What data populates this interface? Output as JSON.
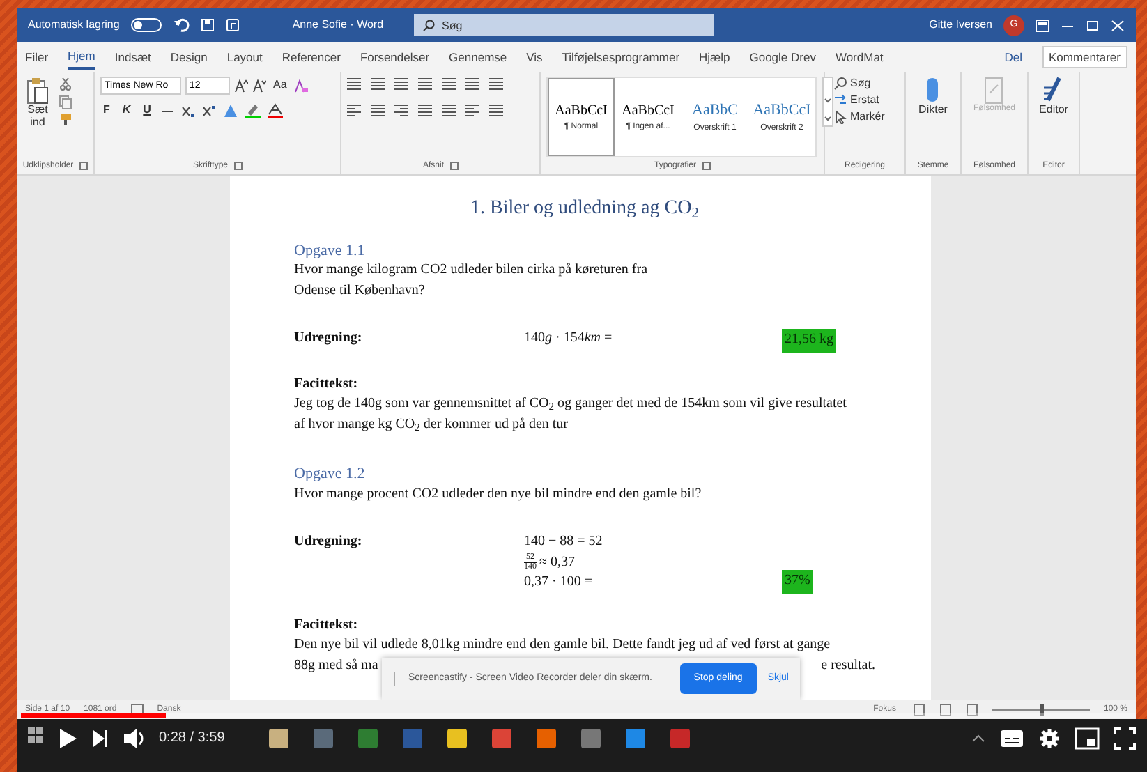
{
  "titlebar": {
    "autosave_label": "Automatisk lagring",
    "autosave_on": false,
    "doc_title": "Anne Sofie - Word",
    "search_placeholder": "Søg",
    "user": "Gitte Iversen",
    "avatar": "G"
  },
  "menu_tabs": [
    {
      "label": "Filer",
      "selected": false
    },
    {
      "label": "Hjem",
      "selected": true
    },
    {
      "label": "Indsæt",
      "selected": false
    },
    {
      "label": "Design",
      "selected": false
    },
    {
      "label": "Layout",
      "selected": false
    },
    {
      "label": "Referencer",
      "selected": false
    },
    {
      "label": "Forsendelser",
      "selected": false
    },
    {
      "label": "Gennemse",
      "selected": false
    },
    {
      "label": "Vis",
      "selected": false
    },
    {
      "label": "Tilføjelsesprogrammer",
      "selected": false
    },
    {
      "label": "Hjælp",
      "selected": false
    },
    {
      "label": "Google Drev",
      "selected": false
    },
    {
      "label": "WordMat",
      "selected": false
    }
  ],
  "share": "Del",
  "comments": "Kommentarer",
  "ribbon": {
    "paste_label": "Sæt ind",
    "font_name": "Times New Ro",
    "font_size": "12",
    "case_button": "Aa",
    "format_buttons": [
      "F",
      "K",
      "U"
    ],
    "styles": [
      {
        "preview": "AaBbCcI",
        "label": "¶ Normal",
        "kind": "normal",
        "selected": true
      },
      {
        "preview": "AaBbCcI",
        "label": "¶ Ingen af...",
        "kind": "normal",
        "selected": false
      },
      {
        "preview": "AaBbC",
        "label": "Overskrift 1",
        "kind": "heading",
        "selected": false
      },
      {
        "preview": "AaBbCcI",
        "label": "Overskrift 2",
        "kind": "heading",
        "selected": false
      }
    ],
    "editing": [
      "Søg",
      "Erstat",
      "Markér"
    ],
    "dictate": "Dikter",
    "sensitivity": "Følsomhed",
    "editor": "Editor",
    "groups": [
      "Udklipsholder",
      "Skrifttype",
      "Afsnit",
      "Typografier",
      "Redigering",
      "Stemme",
      "Følsomhed",
      "Editor"
    ]
  },
  "document": {
    "title": "1. Biler og udledning ag CO$_{2}$",
    "sections": [
      {
        "heading": "Opgave 1.1",
        "question": [
          "Hvor mange kilogram CO2 udleder bilen cirka på køreturen fra",
          "Odense til København?"
        ],
        "calc_label": "Udregning:",
        "calc_lines": [
          {
            "kind": "parts",
            "parts": [
              {
                "text": "140",
                "italic": false
              },
              {
                "text": "g",
                "italic": true
              },
              {
                "text": " · 154",
                "italic": false
              },
              {
                "text": "km",
                "italic": true
              },
              {
                "text": " =",
                "italic": false
              }
            ]
          }
        ],
        "result": "21,56 kg",
        "facit_label": "Facittekst:",
        "facit": [
          "Jeg tog de 140g som var gennemsnittet af CO$_{2}$ og ganger det med de 154km som vil give resultatet",
          "af hvor mange kg CO$_{2}$ der kommer ud på den tur"
        ]
      },
      {
        "heading": "Opgave 1.2",
        "question": [
          "Hvor mange procent CO2 udleder den nye bil mindre end den gamle bil?"
        ],
        "calc_label": "Udregning:",
        "calc_lines": [
          {
            "kind": "text",
            "text": "140 − 88 = 52"
          },
          {
            "kind": "fraction",
            "numerator": "52",
            "denominator": "140",
            "text": "≈ 0,37"
          },
          {
            "kind": "text",
            "text": "0,37 · 100 ="
          }
        ],
        "result": "37%",
        "facit_label": "Facittekst:",
        "facit": [
          "Den nye bil vil udlede 8,01kg mindre end den gamle bil. Dette fandt jeg ud af ved først at gange"
        ],
        "facit_split": [
          "88g med så ma",
          "e resultat."
        ]
      }
    ]
  },
  "share_bar": {
    "message": "Screencastify - Screen Video Recorder deler din skærm.",
    "stop": "Stop deling",
    "hide": "Skjul"
  },
  "status_bar": {
    "page": "Side 1 af 10",
    "words": "1081 ord",
    "language": "Dansk",
    "focus": "Fokus",
    "zoom": "100 %",
    "zoom_slider": {
      "level": 0.5
    }
  },
  "player": {
    "time": "0:28 / 3:59",
    "progress": {
      "level": 0.13
    }
  }
}
